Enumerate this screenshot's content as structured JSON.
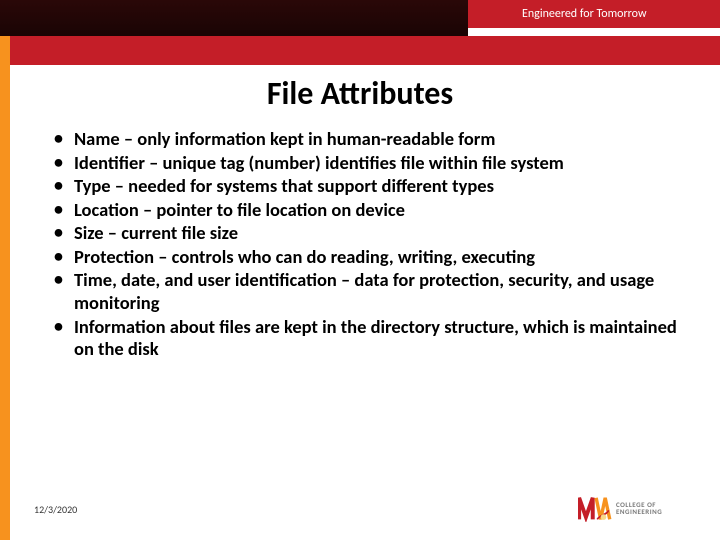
{
  "header": {
    "tagline": "Engineered for Tomorrow"
  },
  "title": "File Attributes",
  "bullets": [
    "Name – only information kept in human-readable form",
    "Identifier – unique tag (number) identifies file within file system",
    "Type – needed for systems that support different types",
    "Location – pointer to file location on device",
    "Size – current file size",
    "Protection – controls who can do reading, writing, executing",
    "Time, date, and user identification – data for protection, security, and usage monitoring",
    "Information about files are kept in the directory structure, which is maintained on the disk"
  ],
  "footer": {
    "date": "12/3/2020",
    "logo": {
      "line1": "COLLEGE OF",
      "line2": "ENGINEERING",
      "sub": ""
    }
  }
}
